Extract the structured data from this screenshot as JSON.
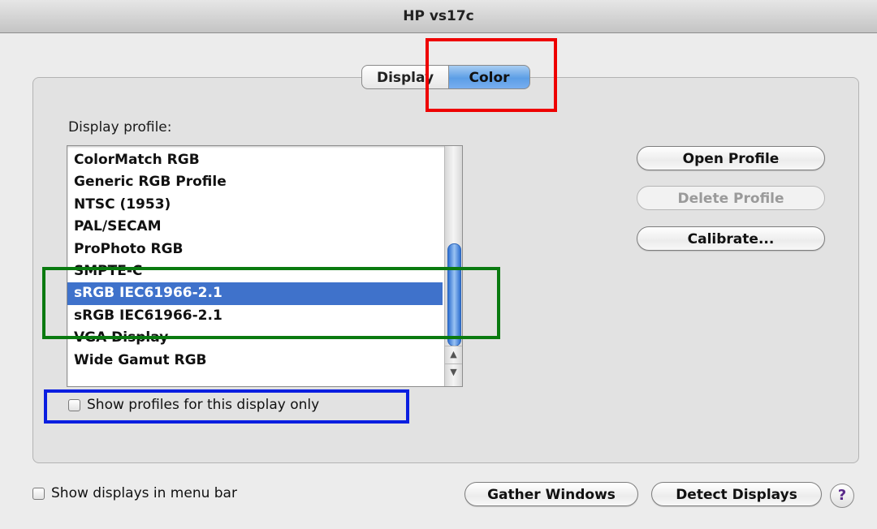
{
  "window": {
    "title": "HP vs17c"
  },
  "tabs": [
    {
      "label": "Display",
      "selected": false
    },
    {
      "label": "Color",
      "selected": true
    }
  ],
  "profiles": {
    "label": "Display profile:",
    "items": [
      {
        "label": "ColorMatch RGB",
        "selected": false
      },
      {
        "label": "Generic RGB Profile",
        "selected": false
      },
      {
        "label": "NTSC (1953)",
        "selected": false
      },
      {
        "label": "PAL/SECAM",
        "selected": false
      },
      {
        "label": "ProPhoto RGB",
        "selected": false
      },
      {
        "label": "SMPTE-C",
        "selected": false
      },
      {
        "label": "sRGB IEC61966-2.1",
        "selected": true
      },
      {
        "label": "sRGB IEC61966-2.1",
        "selected": false
      },
      {
        "label": "VGA Display",
        "selected": false
      },
      {
        "label": "Wide Gamut RGB",
        "selected": false
      }
    ],
    "show_only_label": "Show profiles for this display only",
    "show_only_checked": false
  },
  "buttons": {
    "open_profile": "Open Profile",
    "delete_profile": "Delete Profile",
    "calibrate": "Calibrate...",
    "gather_windows": "Gather Windows",
    "detect_displays": "Detect Displays",
    "help": "?"
  },
  "footer": {
    "menu_bar_label": "Show displays in menu bar",
    "menu_bar_checked": false
  },
  "colors": {
    "selection": "#3f72cb",
    "annotation_red": "#ee0000",
    "annotation_green": "#0a7a10",
    "annotation_blue": "#0a1ee0"
  }
}
